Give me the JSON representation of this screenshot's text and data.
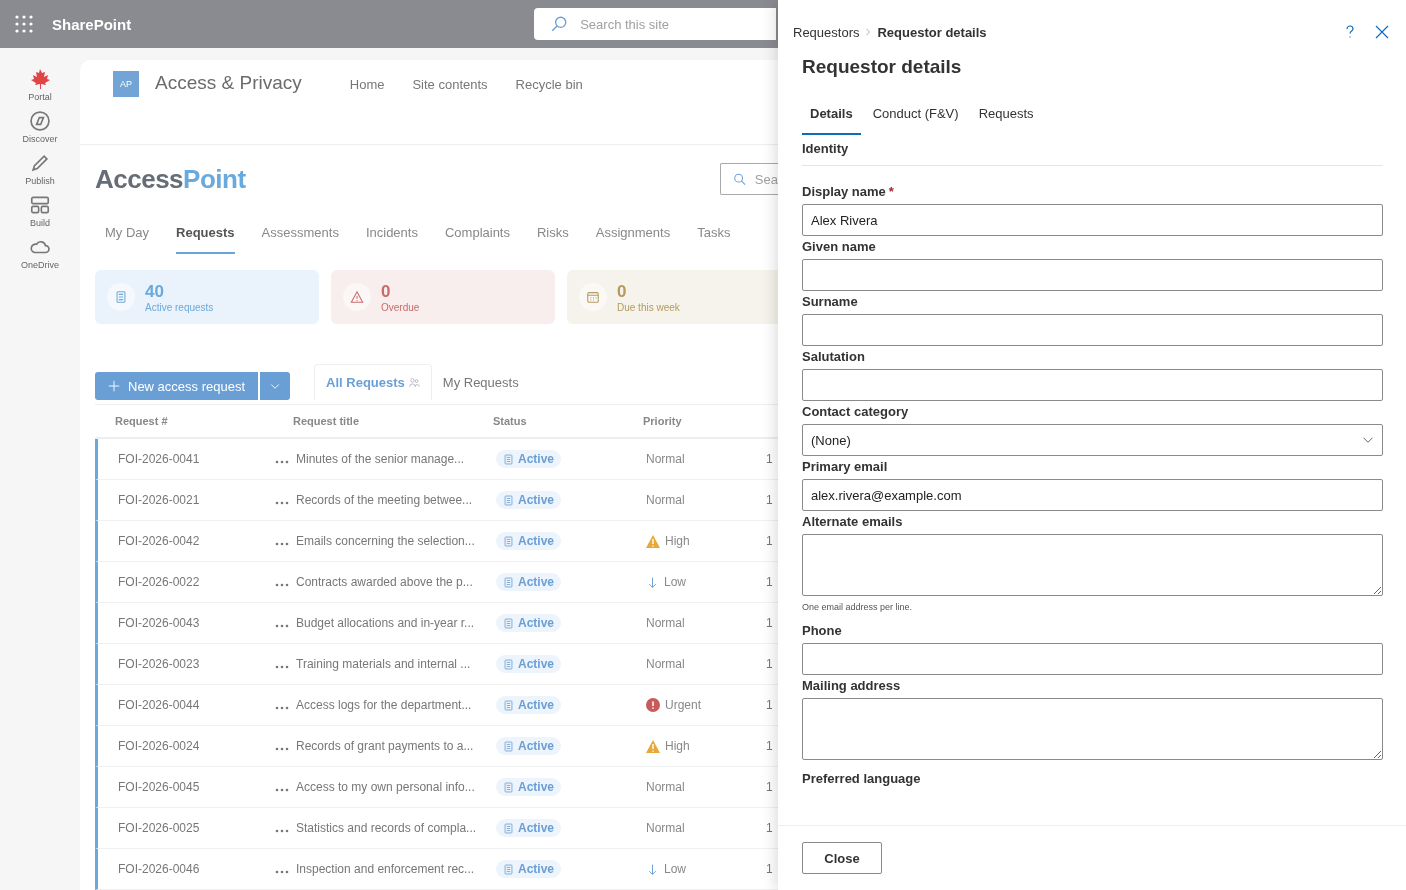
{
  "suite_bar": {
    "app_name": "SharePoint",
    "search": {
      "placeholder": "Search this site"
    }
  },
  "app_rail": [
    {
      "label": "Portal",
      "kind": "leaf"
    },
    {
      "label": "Discover",
      "kind": "compass"
    },
    {
      "label": "Publish",
      "kind": "pen"
    },
    {
      "label": "Build",
      "kind": "grid"
    },
    {
      "label": "OneDrive",
      "kind": "cloud"
    }
  ],
  "site_header": {
    "logo": "AP",
    "title": "Access & Privacy",
    "nav": [
      "Home",
      "Site contents",
      "Recycle bin"
    ]
  },
  "app": {
    "brand": [
      {
        "text": "Access",
        "accent": false
      },
      {
        "text": "Point",
        "accent": true
      }
    ],
    "search": {
      "placeholder": "Sea"
    },
    "tabs": [
      {
        "label": "My Day",
        "selected": false
      },
      {
        "label": "Requests",
        "selected": true
      },
      {
        "label": "Assessments",
        "selected": false
      },
      {
        "label": "Incidents",
        "selected": false
      },
      {
        "label": "Complaints",
        "selected": false
      },
      {
        "label": "Risks",
        "selected": false
      },
      {
        "label": "Assignments",
        "selected": false
      },
      {
        "label": "Tasks",
        "selected": false
      }
    ],
    "stats": [
      {
        "kind": "info",
        "value": "40",
        "label": "Active requests"
      },
      {
        "kind": "danger",
        "value": "0",
        "label": "Overdue"
      },
      {
        "kind": "warning",
        "value": "0",
        "label": "Due this week"
      }
    ],
    "new_button": "New access request",
    "views": [
      {
        "label": "All Requests",
        "selected": true
      },
      {
        "label": "My Requests",
        "selected": false
      }
    ],
    "table": {
      "columns": [
        "Request #",
        "Request title",
        "Status",
        "Priority"
      ],
      "rows": [
        {
          "id": "FOI-2026-0041",
          "title": "Minutes of the senior manage...",
          "status": "Active",
          "priority": {
            "kind": "normal",
            "label": "Normal"
          },
          "column_5": "1"
        },
        {
          "id": "FOI-2026-0021",
          "title": "Records of the meeting betwee...",
          "status": "Active",
          "priority": {
            "kind": "normal",
            "label": "Normal"
          },
          "column_5": "1"
        },
        {
          "id": "FOI-2026-0042",
          "title": "Emails concerning the selection...",
          "status": "Active",
          "priority": {
            "kind": "high",
            "label": "High"
          },
          "column_5": "1"
        },
        {
          "id": "FOI-2026-0022",
          "title": "Contracts awarded above the p...",
          "status": "Active",
          "priority": {
            "kind": "low",
            "label": "Low"
          },
          "column_5": "1"
        },
        {
          "id": "FOI-2026-0043",
          "title": "Budget allocations and in-year r...",
          "status": "Active",
          "priority": {
            "kind": "normal",
            "label": "Normal"
          },
          "column_5": "1"
        },
        {
          "id": "FOI-2026-0023",
          "title": "Training materials and internal ...",
          "status": "Active",
          "priority": {
            "kind": "normal",
            "label": "Normal"
          },
          "column_5": "1"
        },
        {
          "id": "FOI-2026-0044",
          "title": "Access logs for the department...",
          "status": "Active",
          "priority": {
            "kind": "urgent",
            "label": "Urgent"
          },
          "column_5": "1"
        },
        {
          "id": "FOI-2026-0024",
          "title": "Records of grant payments to a...",
          "status": "Active",
          "priority": {
            "kind": "high",
            "label": "High"
          },
          "column_5": "1"
        },
        {
          "id": "FOI-2026-0045",
          "title": "Access to my own personal info...",
          "status": "Active",
          "priority": {
            "kind": "normal",
            "label": "Normal"
          },
          "column_5": "1"
        },
        {
          "id": "FOI-2026-0025",
          "title": "Statistics and records of compla...",
          "status": "Active",
          "priority": {
            "kind": "normal",
            "label": "Normal"
          },
          "column_5": "1"
        },
        {
          "id": "FOI-2026-0046",
          "title": "Inspection and enforcement rec...",
          "status": "Active",
          "priority": {
            "kind": "low",
            "label": "Low"
          },
          "column_5": "1"
        }
      ]
    }
  },
  "panel": {
    "breadcrumb": [
      "Requestors",
      "Requestor details"
    ],
    "title": "Requestor details",
    "tabs": [
      {
        "label": "Details",
        "selected": true
      },
      {
        "label": "Conduct (F&V)",
        "selected": false
      },
      {
        "label": "Requests",
        "selected": false
      }
    ],
    "section": "Identity",
    "fields": [
      {
        "kind": "text",
        "label": "Display name",
        "required_mark": "*",
        "value": "Alex Rivera"
      },
      {
        "kind": "text",
        "label": "Given name"
      },
      {
        "kind": "text",
        "label": "Surname"
      },
      {
        "kind": "text",
        "label": "Salutation"
      },
      {
        "kind": "select",
        "label": "Contact category",
        "value": "(None)"
      },
      {
        "kind": "text",
        "label": "Primary email",
        "value": "alex.rivera@example.com"
      },
      {
        "kind": "textarea",
        "label": "Alternate emails",
        "hint": "One email address per line."
      },
      {
        "kind": "text",
        "label": "Phone"
      },
      {
        "kind": "textarea",
        "label": "Mailing address"
      },
      {
        "kind": "label",
        "label": "Preferred language"
      }
    ],
    "close_button": "Close"
  }
}
